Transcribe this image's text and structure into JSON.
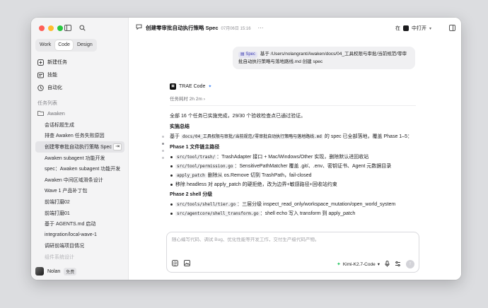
{
  "sidebar": {
    "modes": [
      "Work",
      "Code",
      "Design"
    ],
    "active_mode": "Code",
    "nav": [
      {
        "label": "新建任务",
        "icon": "new-task-icon"
      },
      {
        "label": "技能",
        "icon": "skills-icon"
      },
      {
        "label": "自动化",
        "icon": "automation-icon"
      }
    ],
    "section_label": "任务列表",
    "folder": "Awaken",
    "tasks": [
      "会话标题生成",
      "排查 Awaken 任务失败原因",
      "创建零审批自动执行策略 Spec",
      "Awaken subagent 功能开发",
      "spec：Awaken subagent 功能开发",
      "Awaken 中间区域滑条设计",
      "Wave 1 产品补丁包",
      "前端打磨02",
      "前端打磨01",
      "基于 AGENTS.md 启动",
      "integration/local-wave-1",
      "调研前端项目情况",
      "组件系统设计"
    ],
    "selected_task_index": 2,
    "user": {
      "name": "Nolan",
      "plan": "免费"
    }
  },
  "header": {
    "title": "创建零审批自动执行策略 Spec",
    "date": "07月06日 15:16",
    "more": "···",
    "open_in_prefix": "在",
    "open_in_app": "中打开"
  },
  "user_message": {
    "chip": "Spec",
    "text": "基于 /Users/nolangrant/Awaken/docs/04_工具权限与审批/当前规范/零审批自动执行策略与落地路线.md 创建 spec"
  },
  "assistant": {
    "name": "TRAE Code",
    "duration": "任务耗时 2h 2m",
    "intro": "全部 16 个任务已实施完成，29/30 个验收检查点已通过验证。",
    "summary_heading": "实施总结",
    "summary": {
      "pre": "基于",
      "code": "docs/04_工具权限与审批/当前规范/零审批自动执行策略与落地路线.md",
      "post": "的 spec 已全部落地，覆盖 Phase 1–5："
    },
    "phase1_heading": "Phase 1 文件链主路径",
    "phase1": [
      {
        "code": "src/tool/trash/",
        "text": "：TrashAdapter 接口 + Mac/Windows/Other 实现，删除默认进回收站"
      },
      {
        "code": "src/tool/permission.go",
        "text": "：SensitivePathMatcher 覆盖 .git/、.env、密钥证书、Agent 元数据目录"
      },
      {
        "code": "apply_patch",
        "text": "删除从 os.Remove 切到 TrashPath，fail-closed"
      },
      {
        "code": "",
        "text": "移除 headless 对 apply_patch 的硬拒绝，改为边界+敏感路径+回收站约束"
      }
    ],
    "phase2_heading": "Phase 2 shell 分级",
    "phase2": [
      {
        "code": "src/tools/shell/tier.go",
        "text": "：三层分级 inspect_read_only/workspace_mutation/open_world_system"
      },
      {
        "code": "src/agentcore/shell_transform.go",
        "text": "：shell echo 写入 transform 到 apply_patch"
      }
    ]
  },
  "composer": {
    "placeholder": "随心编写代码、调试 Bug、优化性能等开发工作，交付生产级代码产物。",
    "model": "Kimi-K2.7-Code"
  },
  "colors": {
    "accent": "#3b82f6",
    "sidebar_bg": "#f4f4f5",
    "selected_bg": "#e4e4e7"
  }
}
